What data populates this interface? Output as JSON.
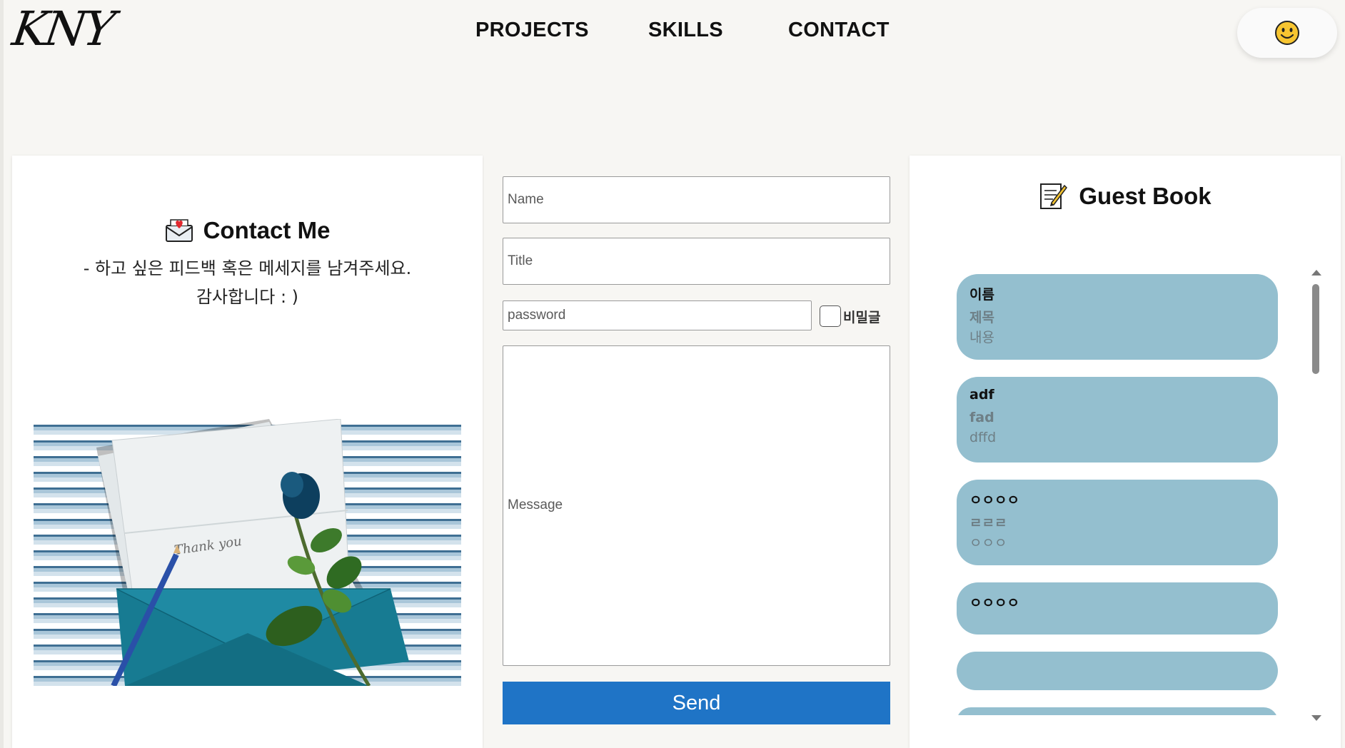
{
  "header": {
    "logo": "KNY",
    "nav": [
      "PROJECTS",
      "SKILLS",
      "CONTACT"
    ],
    "theme_icon": "smiley-icon"
  },
  "contact": {
    "icon": "love-letter-icon",
    "title": "Contact Me",
    "desc_line1": "- 하고 싶은 피드백 혹은 메세지를 남겨주세요.",
    "desc_line2": "감사합니다 : )",
    "image_text": "Thank you"
  },
  "form": {
    "name_placeholder": "Name",
    "title_placeholder": "Title",
    "password_placeholder": "password",
    "secret_label": "비밀글",
    "message_placeholder": "Message",
    "send_label": "Send",
    "send_color": "#1f74c6"
  },
  "guestbook": {
    "icon": "memo-icon",
    "title": "Guest Book",
    "card_color": "#94bfcf",
    "entries": [
      {
        "name": "이름",
        "subject": "제목",
        "content": "내용"
      },
      {
        "name": "adf",
        "subject": "fad",
        "content": "dffd"
      },
      {
        "name": "ㅇㅇㅇㅇ",
        "subject": "ㄹㄹㄹ",
        "content": "ㅇㅇㅇ"
      },
      {
        "name": "ㅇㅇㅇㅇ",
        "subject": "",
        "content": ""
      }
    ]
  }
}
